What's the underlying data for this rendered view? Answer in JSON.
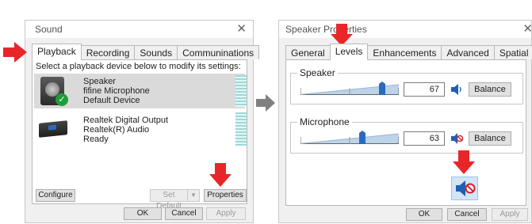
{
  "sound_window": {
    "title": "Sound",
    "tabs": [
      "Playback",
      "Recording",
      "Sounds",
      "Communinations"
    ],
    "active_tab": "Playback",
    "instruction": "Select a playback device below to modify its settings:",
    "devices": [
      {
        "name": "Speaker",
        "line2": "fifine Microphone",
        "status": "Default Device",
        "selected": true,
        "icon": "speaker-icon",
        "badge": "check-icon"
      },
      {
        "name": "Realtek Digital Output",
        "line2": "Realtek(R) Audio",
        "status": "Ready",
        "selected": false,
        "icon": "digital-output-icon"
      }
    ],
    "buttons": {
      "configure": "Configure",
      "set_default": "Set Default",
      "properties": "Properties",
      "ok": "OK",
      "cancel": "Cancel",
      "apply": "Apply"
    }
  },
  "properties_window": {
    "title": "Speaker Properties",
    "tabs": [
      "General",
      "Levels",
      "Enhancements",
      "Advanced",
      "Spatial sound"
    ],
    "active_tab": "Levels",
    "levels": [
      {
        "label": "Speaker",
        "value": "67",
        "muted": false,
        "balance": "Balance"
      },
      {
        "label": "Microphone",
        "value": "63",
        "muted": true,
        "balance": "Balance"
      }
    ],
    "buttons": {
      "ok": "OK",
      "cancel": "Cancel",
      "apply": "Apply"
    }
  },
  "colors": {
    "accent_red": "#e8262a",
    "selected_row": "#dadada",
    "mute_blue": "#1e5fb4",
    "slider_thumb": "#2a6bbf",
    "center_arrow": "#808080"
  }
}
